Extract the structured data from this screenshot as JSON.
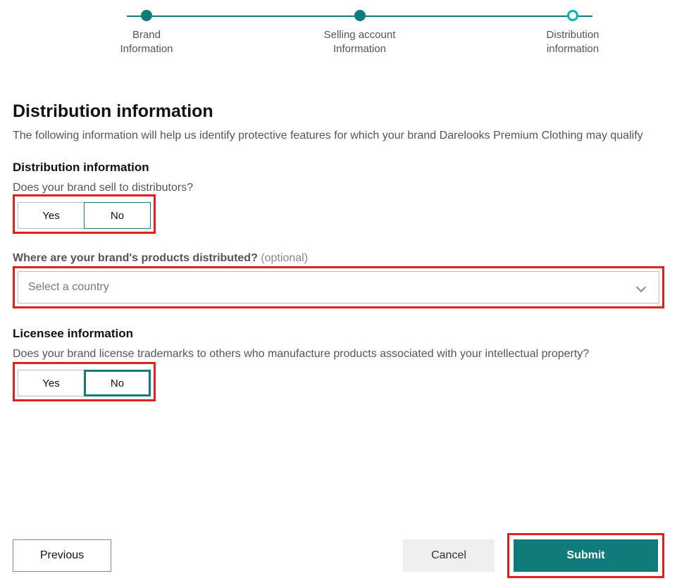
{
  "stepper": {
    "steps": [
      {
        "line1": "Brand",
        "line2": "Information",
        "state": "done"
      },
      {
        "line1": "Selling account",
        "line2": "Information",
        "state": "done"
      },
      {
        "line1": "Distribution",
        "line2": "information",
        "state": "current"
      }
    ]
  },
  "page": {
    "title": "Distribution information",
    "description": "The following information will help us identify protective features for which your brand Darelooks Premium Clothing may qualify"
  },
  "distribution": {
    "section_title": "Distribution information",
    "q1": "Does your brand sell to distributors?",
    "yes": "Yes",
    "no": "No",
    "q2_prefix": "Where are your brand's products distributed?",
    "q2_optional": "(optional)",
    "select_placeholder": "Select a country"
  },
  "licensee": {
    "section_title": "Licensee information",
    "q1": "Does your brand license trademarks to others who manufacture products associated with your intellectual property?",
    "yes": "Yes",
    "no": "No"
  },
  "footer": {
    "previous": "Previous",
    "cancel": "Cancel",
    "submit": "Submit"
  }
}
